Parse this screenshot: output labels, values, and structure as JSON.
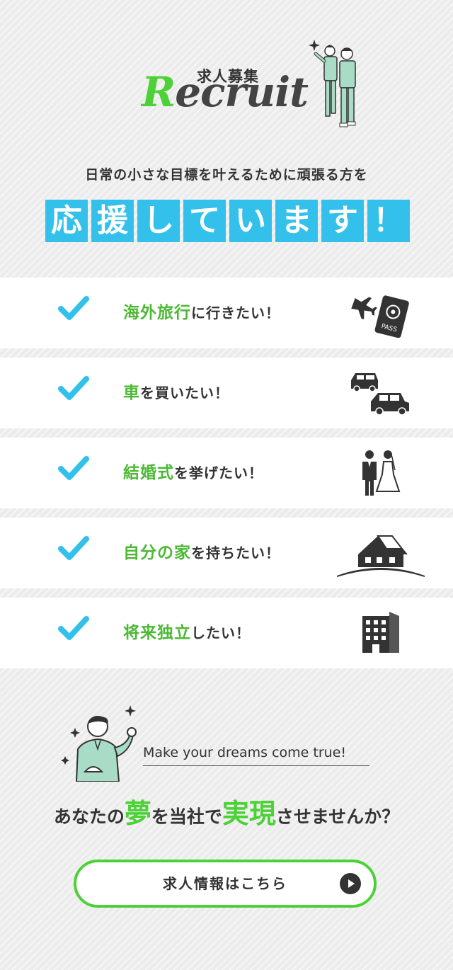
{
  "header": {
    "recruit_ja": "求人募集",
    "recruit_en_first": "R",
    "recruit_en_rest": "ecruit"
  },
  "tagline": "日常の小さな目標を叶えるために頑張る方を",
  "support_chars": [
    "応",
    "援",
    "し",
    "て",
    "い",
    "ま",
    "す",
    "！"
  ],
  "wishes": [
    {
      "highlight": "海外旅行",
      "rest": "に行きたい！",
      "icon": "plane-passport-icon",
      "passport_label": "PASS"
    },
    {
      "highlight": "車",
      "rest": "を買いたい！",
      "icon": "cars-icon"
    },
    {
      "highlight": "結婚式",
      "rest": "を挙げたい！",
      "icon": "wedding-couple-icon"
    },
    {
      "highlight": "自分の家",
      "rest": "を持ちたい！",
      "icon": "house-icon"
    },
    {
      "highlight": "将来独立",
      "rest": "したい！",
      "icon": "office-building-icon"
    }
  ],
  "dream_caption": "Make your dreams come true!",
  "closing": {
    "part1": "あなたの",
    "word1": "夢",
    "part2": "を当社で",
    "word2": "実現",
    "part3": "させませんか？"
  },
  "cta": {
    "label": "求人情報はこちら"
  },
  "colors": {
    "green": "#4cd137",
    "blue": "#33c1ec",
    "dark": "#333333"
  }
}
